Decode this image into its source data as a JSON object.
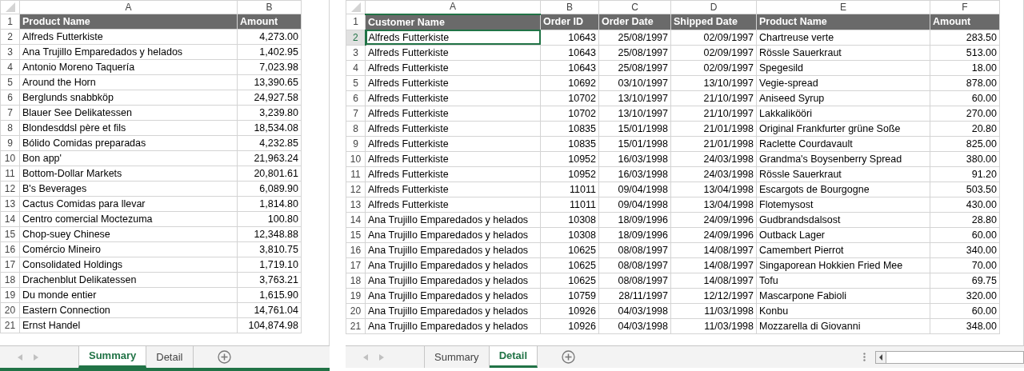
{
  "sheets": [
    {
      "columns": [
        {
          "letter": "A",
          "kind": "text",
          "selected": false
        },
        {
          "letter": "B",
          "kind": "number",
          "selected": false
        }
      ],
      "rows": [
        {
          "number": "1",
          "kind": "header",
          "selected": false,
          "cells": [
            "Product Name",
            "Amount"
          ]
        },
        {
          "number": "2",
          "kind": "data",
          "selected": false,
          "cells": [
            "Alfreds Futterkiste",
            "4,273.00"
          ]
        },
        {
          "number": "3",
          "kind": "data",
          "selected": false,
          "cells": [
            "Ana Trujillo Emparedados y helados",
            "1,402.95"
          ]
        },
        {
          "number": "4",
          "kind": "data",
          "selected": false,
          "cells": [
            "Antonio Moreno Taquería",
            "7,023.98"
          ]
        },
        {
          "number": "5",
          "kind": "data",
          "selected": false,
          "cells": [
            "Around the Horn",
            "13,390.65"
          ]
        },
        {
          "number": "6",
          "kind": "data",
          "selected": false,
          "cells": [
            "Berglunds snabbköp",
            "24,927.58"
          ]
        },
        {
          "number": "7",
          "kind": "data",
          "selected": false,
          "cells": [
            "Blauer See Delikatessen",
            "3,239.80"
          ]
        },
        {
          "number": "8",
          "kind": "data",
          "selected": false,
          "cells": [
            "Blondesddsl père et fils",
            "18,534.08"
          ]
        },
        {
          "number": "9",
          "kind": "data",
          "selected": false,
          "cells": [
            "Bólido Comidas preparadas",
            "4,232.85"
          ]
        },
        {
          "number": "10",
          "kind": "data",
          "selected": false,
          "cells": [
            "Bon app'",
            "21,963.24"
          ]
        },
        {
          "number": "11",
          "kind": "data",
          "selected": false,
          "cells": [
            "Bottom-Dollar Markets",
            "20,801.61"
          ]
        },
        {
          "number": "12",
          "kind": "data",
          "selected": false,
          "cells": [
            "B's Beverages",
            "6,089.90"
          ]
        },
        {
          "number": "13",
          "kind": "data",
          "selected": false,
          "cells": [
            "Cactus Comidas para llevar",
            "1,814.80"
          ]
        },
        {
          "number": "14",
          "kind": "data",
          "selected": false,
          "cells": [
            "Centro comercial Moctezuma",
            "100.80"
          ]
        },
        {
          "number": "15",
          "kind": "data",
          "selected": false,
          "cells": [
            "Chop-suey Chinese",
            "12,348.88"
          ]
        },
        {
          "number": "16",
          "kind": "data",
          "selected": false,
          "cells": [
            "Comércio Mineiro",
            "3,810.75"
          ]
        },
        {
          "number": "17",
          "kind": "data",
          "selected": false,
          "cells": [
            "Consolidated Holdings",
            "1,719.10"
          ]
        },
        {
          "number": "18",
          "kind": "data",
          "selected": false,
          "cells": [
            "Drachenblut Delikatessen",
            "3,763.21"
          ]
        },
        {
          "number": "19",
          "kind": "data",
          "selected": false,
          "cells": [
            "Du monde entier",
            "1,615.90"
          ]
        },
        {
          "number": "20",
          "kind": "data",
          "selected": false,
          "cells": [
            "Eastern Connection",
            "14,761.04"
          ]
        },
        {
          "number": "21",
          "kind": "data",
          "selected": false,
          "cells": [
            "Ernst Handel",
            "104,874.98"
          ]
        }
      ],
      "tabs": [
        {
          "label": "Summary",
          "selected": true
        },
        {
          "label": "Detail",
          "selected": false
        }
      ],
      "status_bar": true,
      "scrollbar": false
    },
    {
      "columns": [
        {
          "letter": "A",
          "kind": "text",
          "selected": true
        },
        {
          "letter": "B",
          "kind": "number",
          "selected": false
        },
        {
          "letter": "C",
          "kind": "number",
          "selected": false
        },
        {
          "letter": "D",
          "kind": "number",
          "selected": false
        },
        {
          "letter": "E",
          "kind": "text",
          "selected": false
        },
        {
          "letter": "F",
          "kind": "number",
          "selected": false
        }
      ],
      "rows": [
        {
          "number": "1",
          "kind": "header",
          "selected": false,
          "cells": [
            "Customer Name",
            "Order ID",
            "Order Date",
            "Shipped Date",
            "Product Name",
            "Amount"
          ]
        },
        {
          "number": "2",
          "kind": "data",
          "selected": true,
          "cells": [
            "Alfreds Futterkiste",
            "10643",
            "25/08/1997",
            "02/09/1997",
            "Chartreuse verte",
            "283.50"
          ]
        },
        {
          "number": "3",
          "kind": "data",
          "selected": false,
          "cells": [
            "Alfreds Futterkiste",
            "10643",
            "25/08/1997",
            "02/09/1997",
            "Rössle Sauerkraut",
            "513.00"
          ]
        },
        {
          "number": "4",
          "kind": "data",
          "selected": false,
          "cells": [
            "Alfreds Futterkiste",
            "10643",
            "25/08/1997",
            "02/09/1997",
            "Spegesild",
            "18.00"
          ]
        },
        {
          "number": "5",
          "kind": "data",
          "selected": false,
          "cells": [
            "Alfreds Futterkiste",
            "10692",
            "03/10/1997",
            "13/10/1997",
            "Vegie-spread",
            "878.00"
          ]
        },
        {
          "number": "6",
          "kind": "data",
          "selected": false,
          "cells": [
            "Alfreds Futterkiste",
            "10702",
            "13/10/1997",
            "21/10/1997",
            "Aniseed Syrup",
            "60.00"
          ]
        },
        {
          "number": "7",
          "kind": "data",
          "selected": false,
          "cells": [
            "Alfreds Futterkiste",
            "10702",
            "13/10/1997",
            "21/10/1997",
            "Lakkalikööri",
            "270.00"
          ]
        },
        {
          "number": "8",
          "kind": "data",
          "selected": false,
          "cells": [
            "Alfreds Futterkiste",
            "10835",
            "15/01/1998",
            "21/01/1998",
            "Original Frankfurter grüne Soße",
            "20.80"
          ]
        },
        {
          "number": "9",
          "kind": "data",
          "selected": false,
          "cells": [
            "Alfreds Futterkiste",
            "10835",
            "15/01/1998",
            "21/01/1998",
            "Raclette Courdavault",
            "825.00"
          ]
        },
        {
          "number": "10",
          "kind": "data",
          "selected": false,
          "cells": [
            "Alfreds Futterkiste",
            "10952",
            "16/03/1998",
            "24/03/1998",
            "Grandma's Boysenberry Spread",
            "380.00"
          ]
        },
        {
          "number": "11",
          "kind": "data",
          "selected": false,
          "cells": [
            "Alfreds Futterkiste",
            "10952",
            "16/03/1998",
            "24/03/1998",
            "Rössle Sauerkraut",
            "91.20"
          ]
        },
        {
          "number": "12",
          "kind": "data",
          "selected": false,
          "cells": [
            "Alfreds Futterkiste",
            "11011",
            "09/04/1998",
            "13/04/1998",
            "Escargots de Bourgogne",
            "503.50"
          ]
        },
        {
          "number": "13",
          "kind": "data",
          "selected": false,
          "cells": [
            "Alfreds Futterkiste",
            "11011",
            "09/04/1998",
            "13/04/1998",
            "Flotemysost",
            "430.00"
          ]
        },
        {
          "number": "14",
          "kind": "data",
          "selected": false,
          "cells": [
            "Ana Trujillo Emparedados y helados",
            "10308",
            "18/09/1996",
            "24/09/1996",
            "Gudbrandsdalsost",
            "28.80"
          ]
        },
        {
          "number": "15",
          "kind": "data",
          "selected": false,
          "cells": [
            "Ana Trujillo Emparedados y helados",
            "10308",
            "18/09/1996",
            "24/09/1996",
            "Outback Lager",
            "60.00"
          ]
        },
        {
          "number": "16",
          "kind": "data",
          "selected": false,
          "cells": [
            "Ana Trujillo Emparedados y helados",
            "10625",
            "08/08/1997",
            "14/08/1997",
            "Camembert Pierrot",
            "340.00"
          ]
        },
        {
          "number": "17",
          "kind": "data",
          "selected": false,
          "cells": [
            "Ana Trujillo Emparedados y helados",
            "10625",
            "08/08/1997",
            "14/08/1997",
            "Singaporean Hokkien Fried Mee",
            "70.00"
          ]
        },
        {
          "number": "18",
          "kind": "data",
          "selected": false,
          "cells": [
            "Ana Trujillo Emparedados y helados",
            "10625",
            "08/08/1997",
            "14/08/1997",
            "Tofu",
            "69.75"
          ]
        },
        {
          "number": "19",
          "kind": "data",
          "selected": false,
          "cells": [
            "Ana Trujillo Emparedados y helados",
            "10759",
            "28/11/1997",
            "12/12/1997",
            "Mascarpone Fabioli",
            "320.00"
          ]
        },
        {
          "number": "20",
          "kind": "data",
          "selected": false,
          "cells": [
            "Ana Trujillo Emparedados y helados",
            "10926",
            "04/03/1998",
            "11/03/1998",
            "Konbu",
            "60.00"
          ]
        },
        {
          "number": "21",
          "kind": "data",
          "selected": false,
          "cells": [
            "Ana Trujillo Emparedados y helados",
            "10926",
            "04/03/1998",
            "11/03/1998",
            "Mozzarella di Giovanni",
            "348.00"
          ]
        }
      ],
      "tabs": [
        {
          "label": "Summary",
          "selected": false
        },
        {
          "label": "Detail",
          "selected": true
        }
      ],
      "status_bar": false,
      "scrollbar": true
    }
  ]
}
